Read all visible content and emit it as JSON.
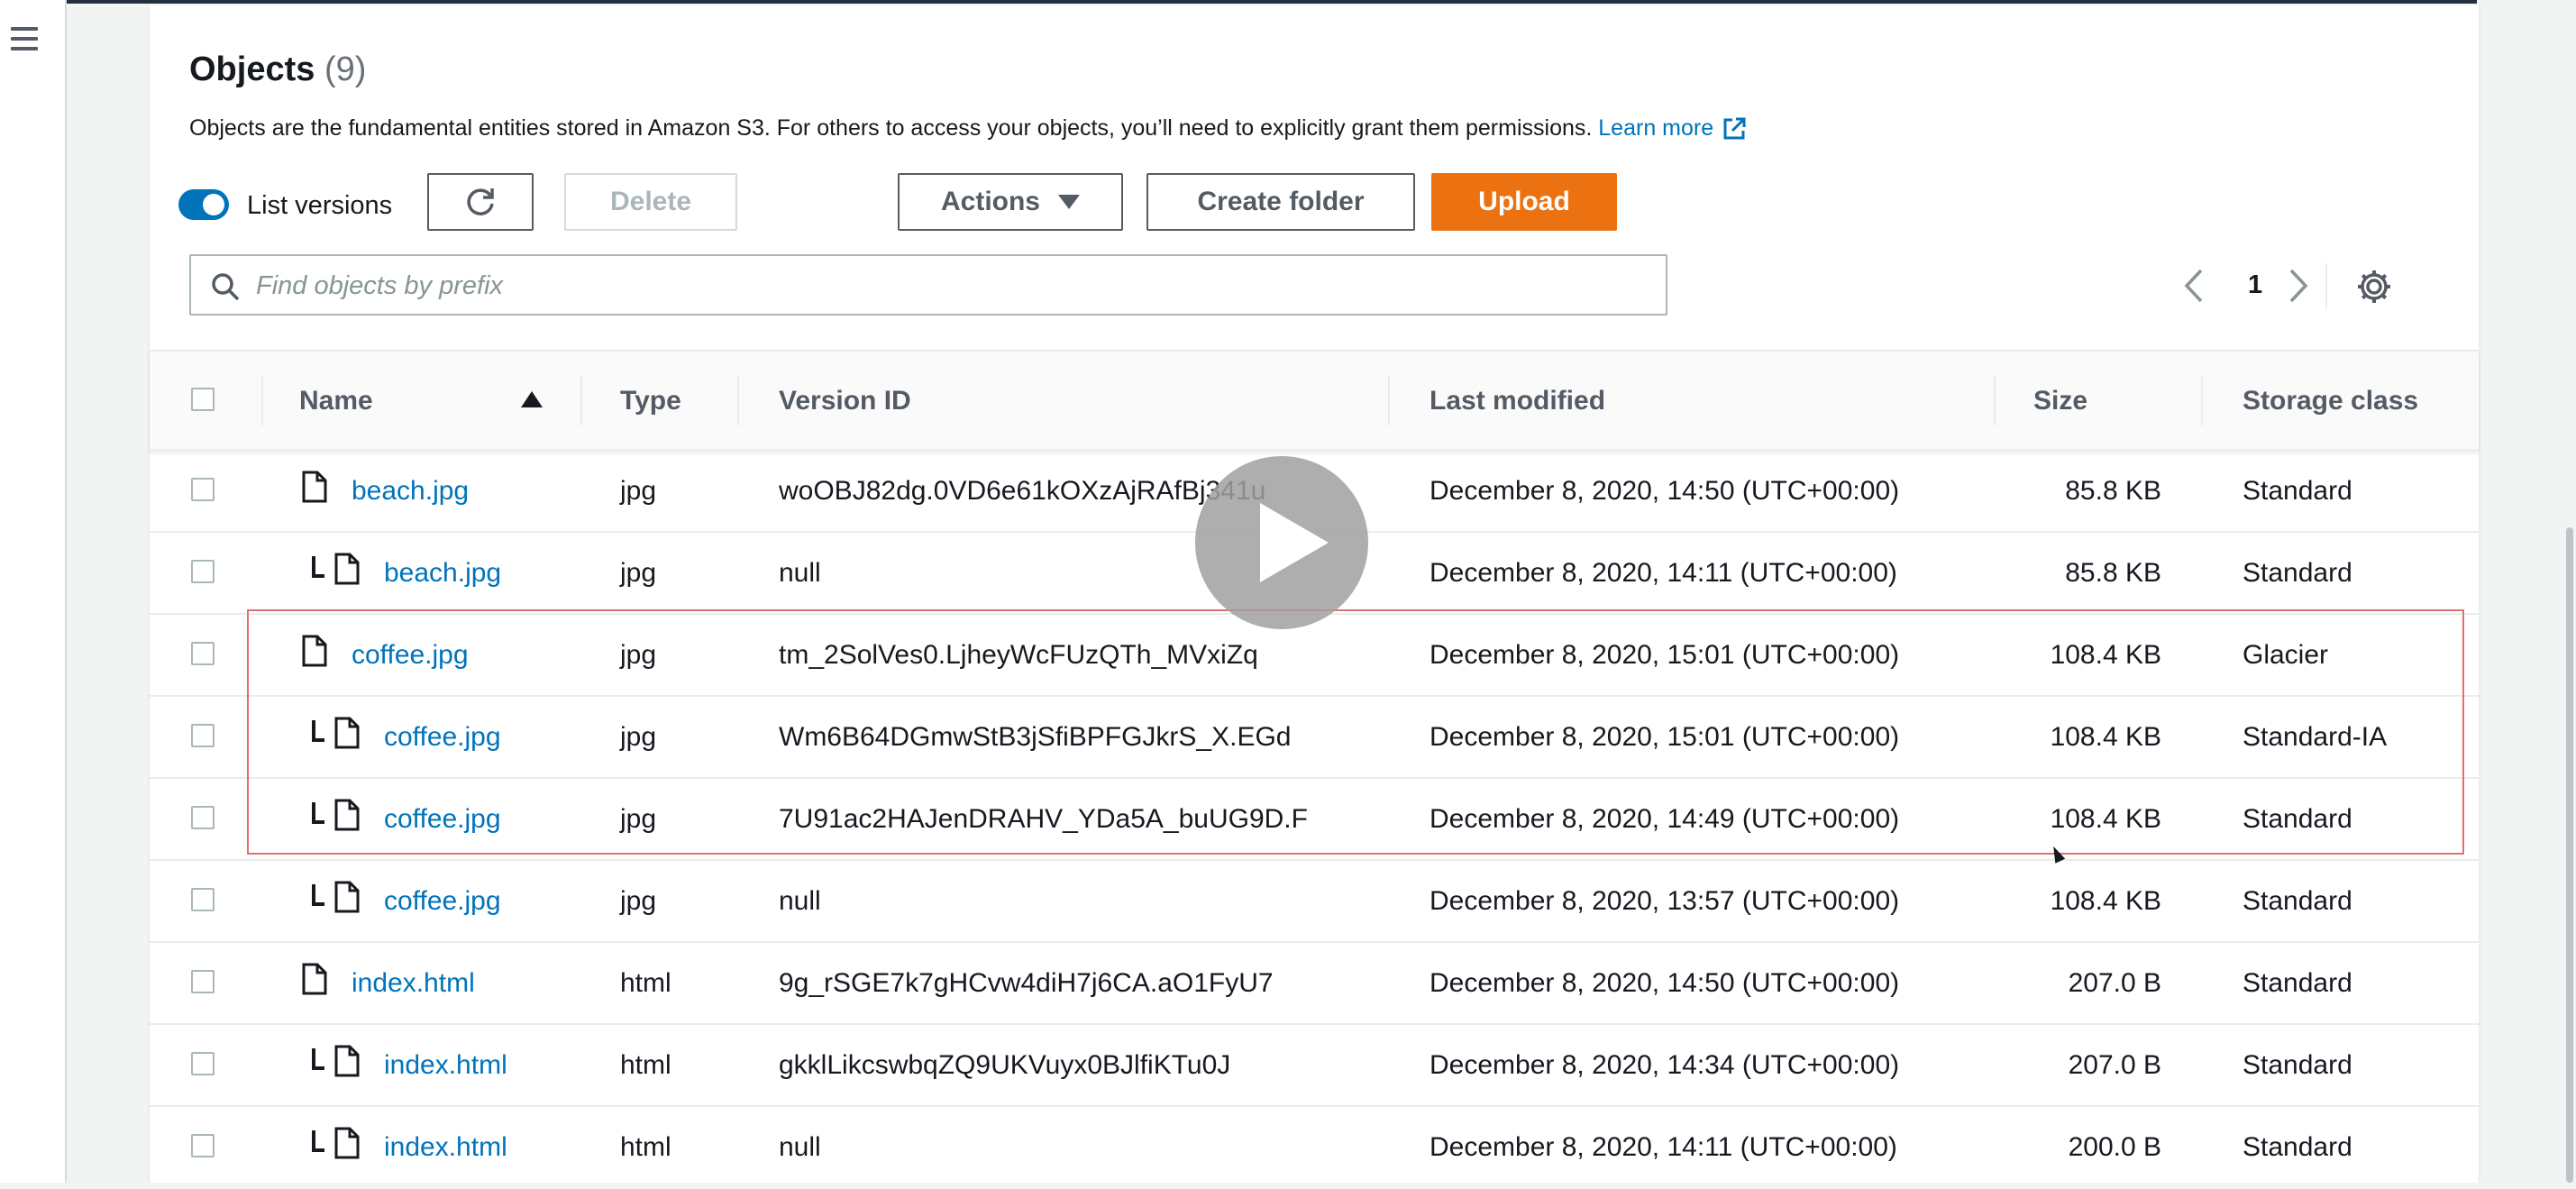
{
  "header": {
    "title": "Objects",
    "count": "(9)",
    "description": "Objects are the fundamental entities stored in Amazon S3. For others to access your objects, you’ll need to explicitly grant them permissions.",
    "learn_more": "Learn more"
  },
  "toolbar": {
    "list_versions_label": "List versions",
    "list_versions_on": true,
    "delete_label": "Delete",
    "actions_label": "Actions",
    "create_folder_label": "Create folder",
    "upload_label": "Upload"
  },
  "search": {
    "placeholder": "Find objects by prefix",
    "value": ""
  },
  "pagination": {
    "current_page": "1"
  },
  "table": {
    "columns": [
      "Name",
      "Type",
      "Version ID",
      "Last modified",
      "Size",
      "Storage class"
    ],
    "sort": {
      "column": "Name",
      "direction": "ascending"
    },
    "rows": [
      {
        "name": "beach.jpg",
        "is_version": false,
        "type": "jpg",
        "version_id": "woOBJ82dg.0VD6e61kOXzAjRAfBj341u",
        "last_modified": "December 8, 2020, 14:50 (UTC+00:00)",
        "size": "85.8 KB",
        "storage_class": "Standard"
      },
      {
        "name": "beach.jpg",
        "is_version": true,
        "type": "jpg",
        "version_id": "null",
        "last_modified": "December 8, 2020, 14:11 (UTC+00:00)",
        "size": "85.8 KB",
        "storage_class": "Standard"
      },
      {
        "name": "coffee.jpg",
        "is_version": false,
        "type": "jpg",
        "version_id": "tm_2SolVes0.LjheyWcFUzQTh_MVxiZq",
        "last_modified": "December 8, 2020, 15:01 (UTC+00:00)",
        "size": "108.4 KB",
        "storage_class": "Glacier"
      },
      {
        "name": "coffee.jpg",
        "is_version": true,
        "type": "jpg",
        "version_id": "Wm6B64DGmwStB3jSfiBPFGJkrS_X.EGd",
        "last_modified": "December 8, 2020, 15:01 (UTC+00:00)",
        "size": "108.4 KB",
        "storage_class": "Standard-IA"
      },
      {
        "name": "coffee.jpg",
        "is_version": true,
        "type": "jpg",
        "version_id": "7U91ac2HAJenDRAHV_YDa5A_buUG9D.F",
        "last_modified": "December 8, 2020, 14:49 (UTC+00:00)",
        "size": "108.4 KB",
        "storage_class": "Standard"
      },
      {
        "name": "coffee.jpg",
        "is_version": true,
        "type": "jpg",
        "version_id": "null",
        "last_modified": "December 8, 2020, 13:57 (UTC+00:00)",
        "size": "108.4 KB",
        "storage_class": "Standard"
      },
      {
        "name": "index.html",
        "is_version": false,
        "type": "html",
        "version_id": "9g_rSGE7k7gHCvw4diH7j6CA.aO1FyU7",
        "last_modified": "December 8, 2020, 14:50 (UTC+00:00)",
        "size": "207.0 B",
        "storage_class": "Standard"
      },
      {
        "name": "index.html",
        "is_version": true,
        "type": "html",
        "version_id": "gkklLikcswbqZQ9UKVuyx0BJlfiKTu0J",
        "last_modified": "December 8, 2020, 14:34 (UTC+00:00)",
        "size": "207.0 B",
        "storage_class": "Standard"
      },
      {
        "name": "index.html",
        "is_version": true,
        "type": "html",
        "version_id": "null",
        "last_modified": "December 8, 2020, 14:11 (UTC+00:00)",
        "size": "200.0 B",
        "storage_class": "Standard"
      }
    ]
  },
  "colors": {
    "link": "#0073bb",
    "primary_button": "#ec7211",
    "toggle_on": "#0073bb",
    "highlight_box": "#e07070"
  },
  "icons": [
    "menu-icon",
    "external-link-icon",
    "refresh-icon",
    "caret-down-icon",
    "search-icon",
    "chevron-left-icon",
    "chevron-right-icon",
    "settings-gear-icon",
    "file-icon",
    "play-icon"
  ]
}
